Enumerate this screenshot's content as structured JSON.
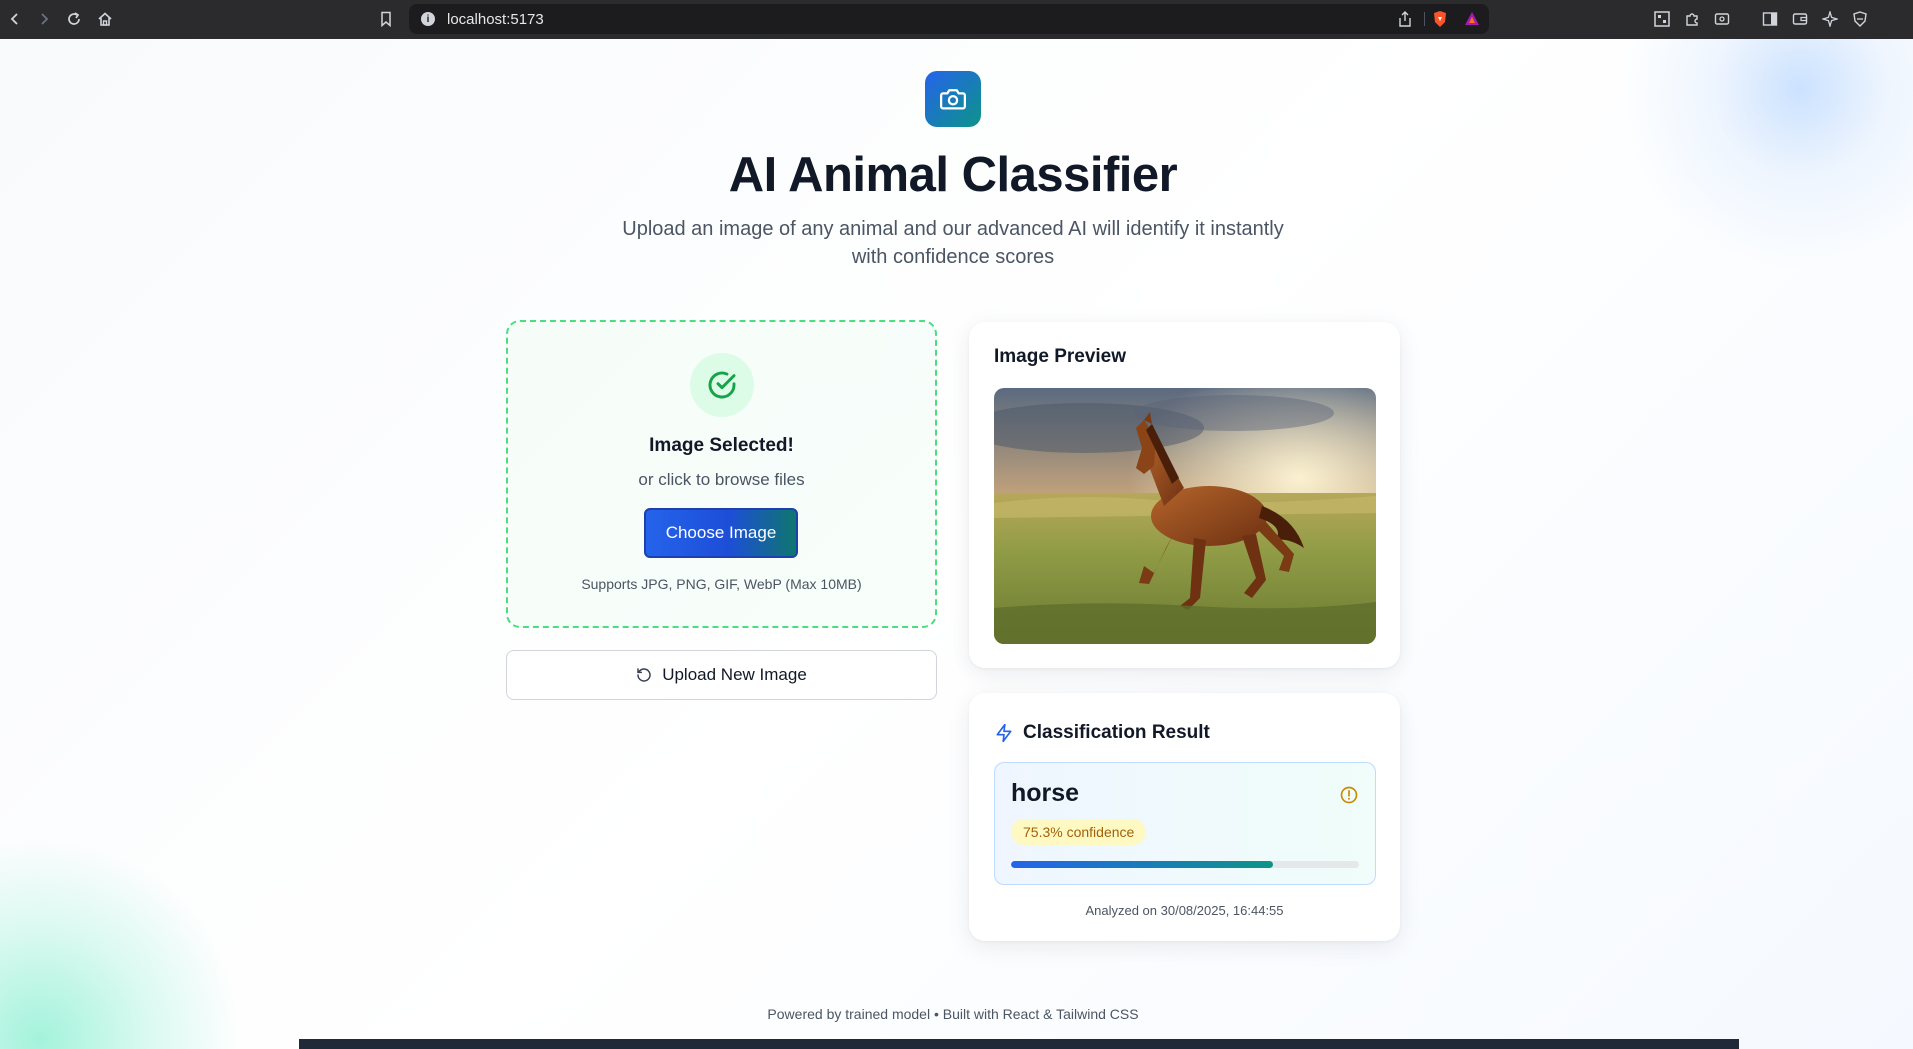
{
  "browser": {
    "url": "localhost:5173"
  },
  "header": {
    "title": "AI Animal Classifier",
    "subtitle": "Upload an image of any animal and our advanced AI will identify it instantly with confidence scores"
  },
  "upload": {
    "heading": "Image Selected!",
    "sub": "or click to browse files",
    "button_label": "Choose Image",
    "supports": "Supports JPG, PNG, GIF, WebP (Max 10MB)",
    "new_button_label": "Upload New Image"
  },
  "preview": {
    "title": "Image Preview"
  },
  "result": {
    "title": "Classification Result",
    "label": "horse",
    "confidence_text": "75.3% confidence",
    "confidence": 0.753,
    "analyzed": "Analyzed on 30/08/2025, 16:44:55"
  },
  "footer": {
    "text": "Powered by trained model • Built with React & Tailwind CSS"
  },
  "colors": {
    "accent": "#2563eb",
    "teal": "#0d9488",
    "success": "#22c55e",
    "warning": "#ca8a04"
  }
}
